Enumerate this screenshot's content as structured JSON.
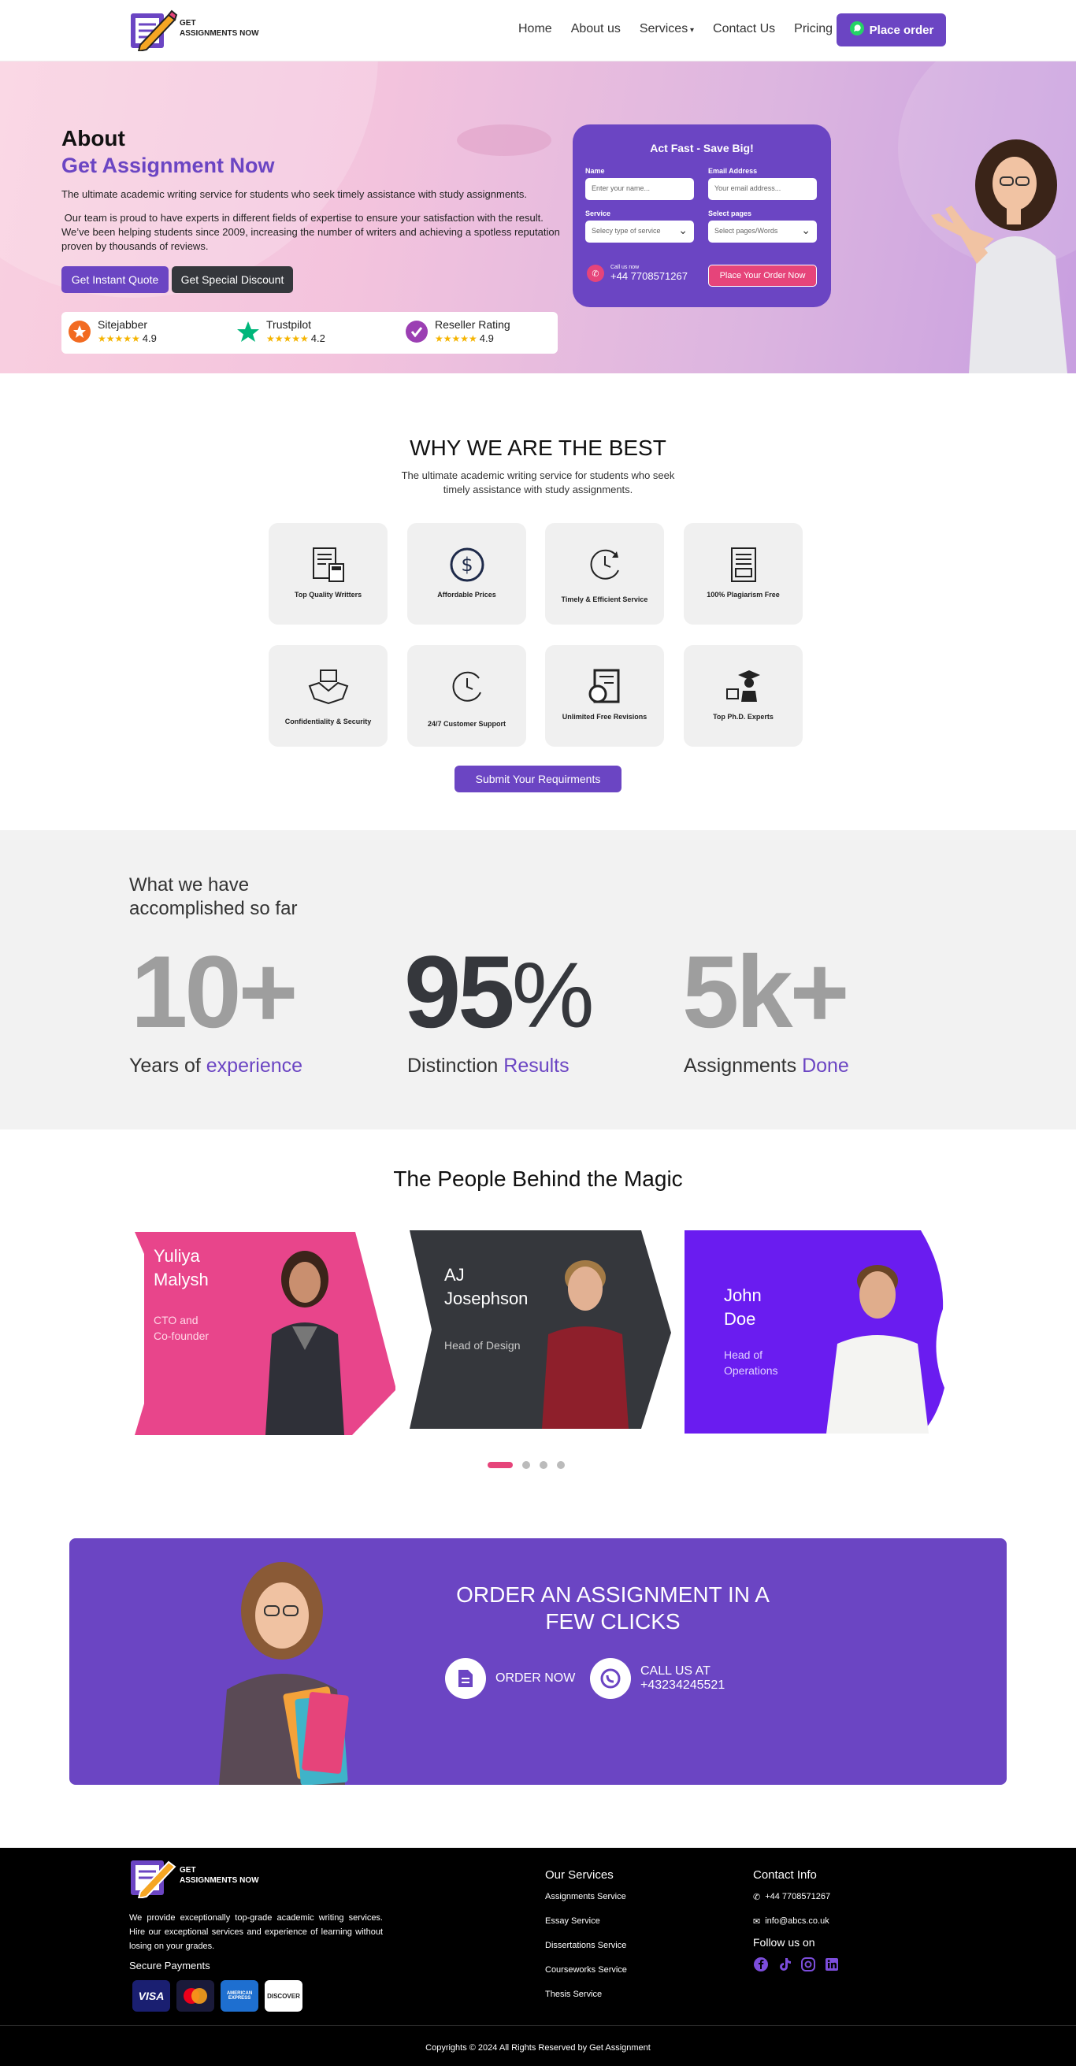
{
  "header": {
    "logo_line1": "GET",
    "logo_line2": "ASSIGNMENTS NOW",
    "nav": [
      "Home",
      "About us",
      "Services",
      "Contact Us",
      "Pricing"
    ],
    "order_button": "Place order"
  },
  "hero": {
    "title": "About",
    "subtitle": "Get Assignment Now",
    "p1": "The ultimate academic writing service for students who seek timely assistance with study assignments.",
    "p2": " Our team is proud to have experts in different fields of expertise to ensure your satisfaction with the result. We’ve been helping students since 2009, increasing the number of writers and achieving a spotless reputation proven by thousands of reviews.",
    "btn_quote": "Get Instant Quote",
    "btn_discount": "Get Special Discount",
    "ratings": [
      {
        "name": "Sitejabber",
        "score": "4.9"
      },
      {
        "name": "Trustpilot",
        "score": "4.2"
      },
      {
        "name": "Reseller Rating",
        "score": "4.9"
      }
    ],
    "form": {
      "title": "Act Fast - Save Big!",
      "name_label": "Name",
      "name_placeholder": "Enter your name...",
      "email_label": "Email Address",
      "email_placeholder": "Your email address...",
      "service_label": "Service",
      "service_value": "Selecy type of service",
      "pages_label": "Select pages",
      "pages_value": "Select pages/Words",
      "call_label": "Call us now",
      "call_number": "+44 7708571267",
      "submit": "Place Your Order Now"
    }
  },
  "why": {
    "title": "WHY WE ARE THE BEST",
    "subtitle": "The ultimate academic writing service for students who seek timely assistance with study assignments.",
    "features": [
      "Top Quality Writters",
      "Affordable Prices",
      "Timely & Efficient Service",
      "100% Plagiarism Free",
      "Confidentiality & Security",
      "24/7 Customer Support",
      "Unlimited Free Revisions",
      "Top Ph.D. Experts"
    ],
    "button": "Submit Your Requirments"
  },
  "stats": {
    "title": "What we have accomplished so far",
    "items": [
      {
        "number": "10+",
        "label": "Years of ",
        "highlight": "experience"
      },
      {
        "number": "95",
        "suffix": "%",
        "label": "Distinction ",
        "highlight": "Results"
      },
      {
        "number": "5k+",
        "label": "Assignments ",
        "highlight": "Done"
      }
    ]
  },
  "team": {
    "title": "The People Behind the Magic",
    "members": [
      {
        "name1": "Yuliya",
        "name2": "Malysh",
        "role1": "CTO and",
        "role2": "Co-founder"
      },
      {
        "name1": "AJ",
        "name2": "Josephson",
        "role1": "Head of Design",
        "role2": ""
      },
      {
        "name1": "John",
        "name2": "Doe",
        "role1": "Head of",
        "role2": "Operations"
      }
    ]
  },
  "cta": {
    "title1": "ORDER AN ASSIGNMENT IN A",
    "title2": "FEW CLICKS",
    "order_now": "ORDER NOW",
    "call_label": "CALL US AT",
    "call_number": "+43234245521"
  },
  "footer": {
    "description": "We provide exceptionally top-grade academic writing services. Hire our exceptional services and experience of learning without losing on your grades.",
    "secure": "Secure Payments",
    "payments": [
      "VISA",
      "MasterCard",
      "AMERICAN EXPRESS",
      "DISCOVER"
    ],
    "services_title": "Our Services",
    "services": [
      "Assignments Service",
      "Essay Service",
      "Dissertations Service",
      "Courseworks Service",
      "Thesis Service"
    ],
    "contact_title": "Contact Info",
    "phone": "+44 7708571267",
    "email": "info@abcs.co.uk",
    "follow": "Follow us on",
    "copyright": "Copyrights © 2024 All Rights Reserved by Get Assignment"
  },
  "colors": {
    "brand": "#6b45c3",
    "accent": "#e6447a",
    "dark": "#35373c"
  }
}
